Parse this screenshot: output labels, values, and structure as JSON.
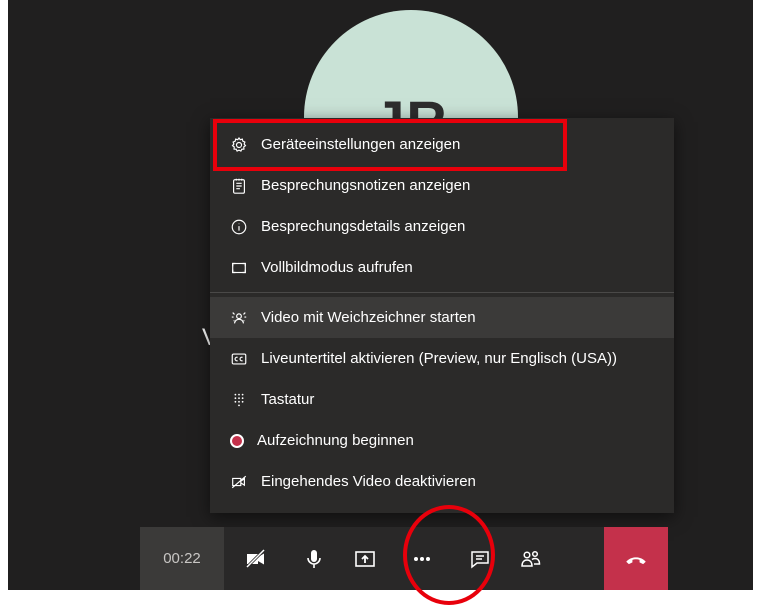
{
  "participant": {
    "initials": "JR",
    "name_fragment": "V"
  },
  "menu": {
    "items": [
      {
        "label": "Geräteeinstellungen anzeigen",
        "icon": "gear-icon"
      },
      {
        "label": "Besprechungsnotizen anzeigen",
        "icon": "notes-icon"
      },
      {
        "label": "Besprechungsdetails anzeigen",
        "icon": "info-icon"
      },
      {
        "label": "Vollbildmodus aufrufen",
        "icon": "fullscreen-icon"
      },
      {
        "label": "Video mit Weichzeichner starten",
        "icon": "blur-icon"
      },
      {
        "label": "Liveuntertitel aktivieren (Preview, nur Englisch (USA))",
        "icon": "cc-icon"
      },
      {
        "label": "Tastatur",
        "icon": "dialpad-icon"
      },
      {
        "label": "Aufzeichnung beginnen",
        "icon": "record-icon"
      },
      {
        "label": "Eingehendes Video deaktivieren",
        "icon": "video-off-icon"
      }
    ]
  },
  "toolbar": {
    "timer": "00:22"
  },
  "colors": {
    "stage_bg": "#201f1f",
    "menu_bg": "#2b2a29",
    "hover_bg": "#3b3a39",
    "hangup": "#c4314b",
    "annotation_red": "#e8000b",
    "avatar_bg": "#c9e2d6"
  }
}
